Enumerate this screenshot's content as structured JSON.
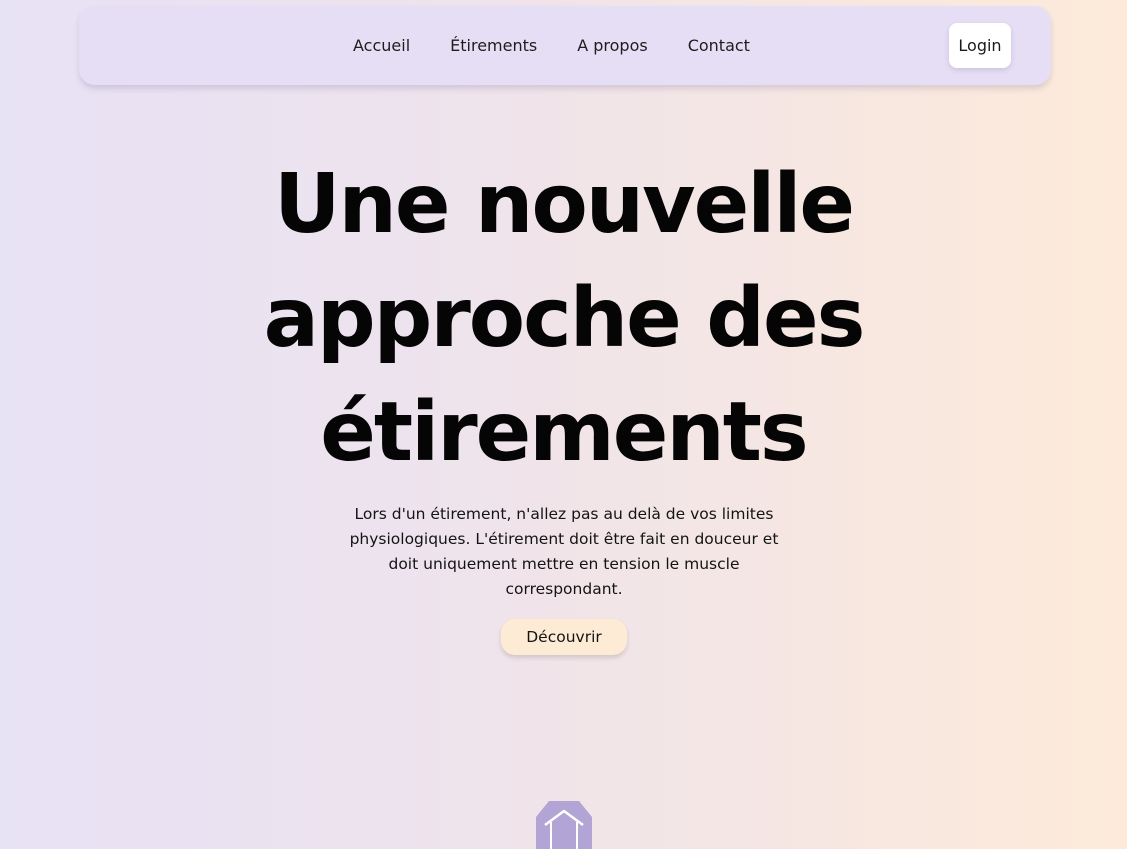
{
  "nav": {
    "links": [
      "Accueil",
      "Étirements",
      "A propos",
      "Contact"
    ],
    "login_label": "Login"
  },
  "hero": {
    "title": "Une nouvelle approche des étirements",
    "description": "Lors d'un étirement, n'allez pas au delà de vos limites physiologiques. L'étirement doit être fait en douceur et doit uniquement mettre en tension le muscle correspondant.",
    "cta_label": "Découvrir"
  },
  "colors": {
    "navbar_bg": "#e6def5",
    "cta_bg": "#fdebd6",
    "accent_purple": "#b3a4d6",
    "text": "#0a0a0a"
  },
  "icons": {
    "scroll_indicator": "house-badge-icon"
  }
}
